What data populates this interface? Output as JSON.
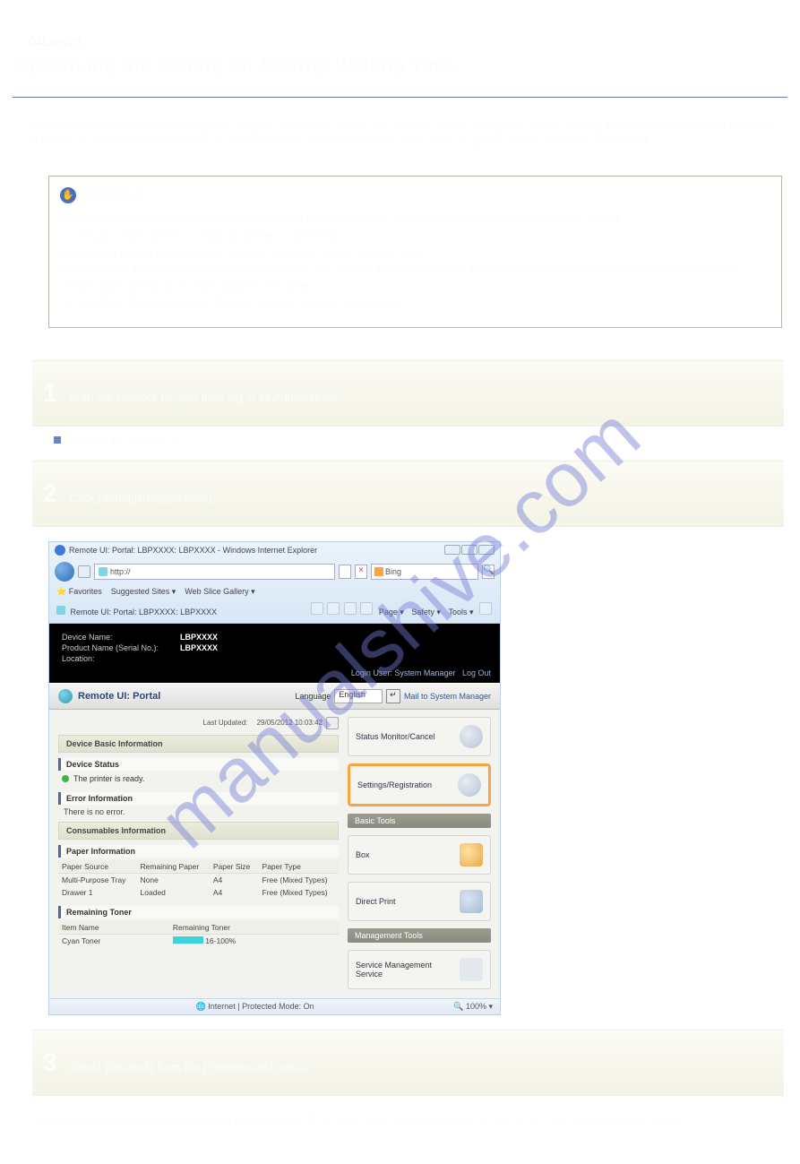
{
  "top_number": "04L9-076",
  "h1": "Specifying the Setting for Startup Waiting Time",
  "intro": "Specify the setting for startup waiting time using the Remote UI. You do not normally need to change the Startup Waiting Time (the time from when the printer is turned on to when the printer starts the communication), but this function is used when the printer cannot connect to the network.",
  "important": {
    "title": "IMPORTANT",
    "lines": [
      "If you turn on the printer after turning off and on the following devices, it may take some time to connect to the network.",
      "• A Hub or other device to which the printer is connected",
      "If the printer cannot connect to the network, set up the Startup Waiting Time.",
      "When you use the spanning tree function with a hub, etc., change the settings so that the printer connects to the network after approximately 2 minutes after turning on the main power of the printer.",
      "For details on the spanning tree function, ask your network administrator."
    ]
  },
  "steps": {
    "s1": {
      "num": "1",
      "text": "Start the Remote UI, and then log in as Administrator."
    },
    "s1_link": "\"Starting the Remote UI\"",
    "s2": {
      "num": "2",
      "text": "Click [Settings/Registration]."
    },
    "s3": {
      "num": "3",
      "text": "Select [Network] from the [Preferences] menu."
    }
  },
  "ok_line": "If you want to specify the setting using the utility software \"FTP Client\" other than the Remote UI, see \"FTP Client\" and download \"config.\"",
  "browser": {
    "title": "Remote UI: Portal: LBPXXXX: LBPXXXX - Windows Internet Explorer",
    "url": "http://",
    "search_engine": "Bing",
    "fav_label": "Favorites",
    "suggested": "Suggested Sites ▾",
    "webslice": "Web Slice Gallery ▾",
    "tab": "Remote UI: Portal: LBPXXXX: LBPXXXX",
    "menu": {
      "page": "Page ▾",
      "safety": "Safety ▾",
      "tools": "Tools ▾"
    }
  },
  "blackhead": {
    "dn_label": "Device Name:",
    "dn_value": "LBPXXXX",
    "pn_label": "Product Name (Serial No.):",
    "pn_value": "LBPXXXX",
    "loc_label": "Location:"
  },
  "loginrow": {
    "login_user": "Login User:",
    "user": "System Manager",
    "logout": "Log Out"
  },
  "portal": {
    "title": "Remote UI: Portal",
    "lang_label": "Language",
    "lang_value": "English",
    "mail": "Mail to System Manager"
  },
  "updated": {
    "label": "Last Updated:",
    "value": "29/05/2012 10:03:42"
  },
  "sections": {
    "basic": "Device Basic Information",
    "dev_status": "Device Status",
    "ready": "The printer is ready.",
    "err_h": "Error Information",
    "noerr": "There is no error.",
    "cons": "Consumables Information",
    "paper_h": "Paper Information",
    "paper_cols": [
      "Paper Source",
      "Remaining Paper",
      "Paper Size",
      "Paper Type"
    ],
    "paper_rows": [
      [
        "Multi-Purpose Tray",
        "None",
        "A4",
        "Free (Mixed Types)"
      ],
      [
        "Drawer 1",
        "Loaded",
        "A4",
        "Free (Mixed Types)"
      ]
    ],
    "toner_h": "Remaining Toner",
    "toner_cols": [
      "Item Name",
      "Remaining Toner"
    ],
    "toner_name": "Cyan Toner",
    "toner_pct": "16-100%"
  },
  "right": {
    "status_monitor": "Status Monitor/Cancel",
    "settings_reg": "Settings/Registration",
    "basic_tools": "Basic Tools",
    "box": "Box",
    "direct_print": "Direct Print",
    "mgmt_tools": "Management Tools",
    "sms": "Service Management Service"
  },
  "statusbar": {
    "zone": "Internet | Protected Mode: On",
    "zoom": "100%"
  },
  "watermark": "manualshive.com"
}
